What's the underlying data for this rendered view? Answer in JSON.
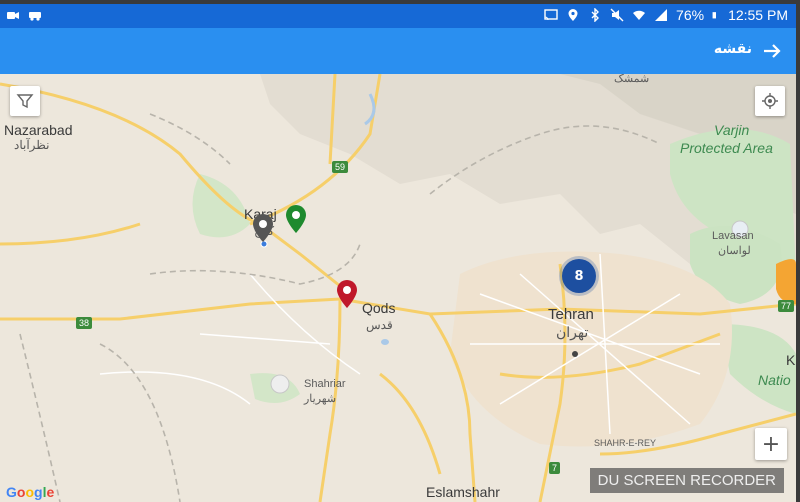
{
  "statusbar": {
    "battery": "76%",
    "time": "12:55 PM",
    "left_icons": [
      "video-camera-icon",
      "car-icon"
    ],
    "right_icons": [
      "cast-icon",
      "location-icon",
      "bluetooth-icon",
      "mute-icon",
      "wifi-icon",
      "signal-icon",
      "battery-icon"
    ]
  },
  "appbar": {
    "title": "نقشه",
    "back_icon": "arrow-right-icon",
    "color": "#2a8ff0"
  },
  "map": {
    "filter_icon": "filter-icon",
    "locate_icon": "my-location-icon",
    "zoom_in": "+",
    "cluster_count": "8",
    "labels": {
      "nazarabad": "Nazarabad",
      "nazarabad_fa": "نظرآباد",
      "karaj": "Karaj",
      "karaj_fa": "کرج",
      "qods": "Qods",
      "qods_fa": "قدس",
      "shahriar": "Shahriar",
      "shahriar_fa": "شهریار",
      "tehran": "Tehran",
      "tehran_fa": "تهران",
      "lavasan": "Lavasan",
      "lavasan_fa": "لواسان",
      "varjin_1": "Varjin",
      "varjin_2": "Protected Area",
      "shemshak_fa": "شمشک",
      "shahr_e_rey": "SHAHR-E-REY",
      "eslamshahr": "Eslamshahr",
      "nation_1": "K",
      "nation_2": "Natio"
    },
    "road_shields": {
      "r59": "59",
      "r38": "38",
      "r7": "7",
      "r77": "77"
    },
    "markers": {
      "gray": "#555555",
      "green": "#1e8a2e",
      "red": "#c0182b"
    }
  },
  "footer": {
    "google": [
      "G",
      "o",
      "o",
      "g",
      "l",
      "e"
    ],
    "google_colors": [
      "#4285F4",
      "#EA4335",
      "#FBBC05",
      "#4285F4",
      "#34A853",
      "#EA4335"
    ],
    "watermark": "DU SCREEN RECORDER"
  }
}
